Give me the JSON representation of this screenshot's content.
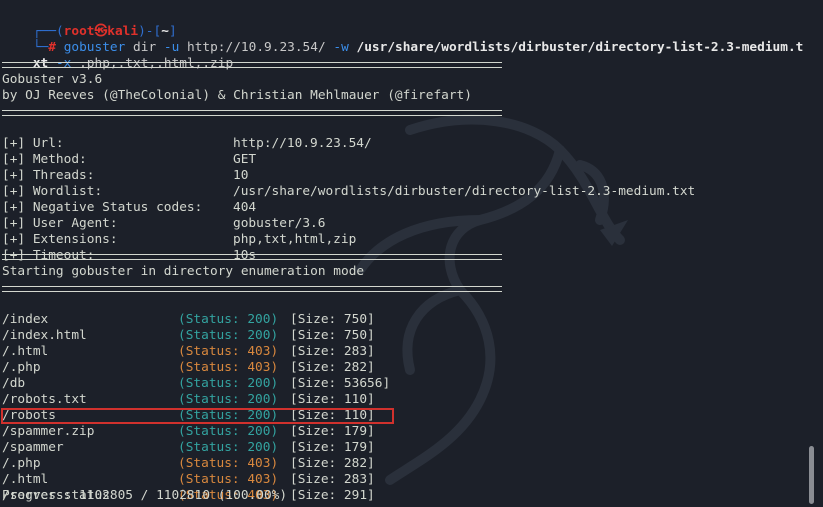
{
  "prompt": {
    "corner_top": "┌──(",
    "user": "root㉿kali",
    "close_paren": ")-[",
    "dir": "~",
    "close_bracket": "]",
    "corner_bottom": "└─",
    "hash": "#"
  },
  "command": {
    "tool": "gobuster",
    "args1": " dir ",
    "flag_u": "-u",
    "url": " http://10.9.23.54/ ",
    "flag_w": "-w",
    "wordlist_part1": " /usr/share/wordlists/dirbuster/directory-list-2.3-medium.t",
    "wordlist_part2": "xt",
    "flag_x": " -x",
    "extensions": " .php,.txt,.html,.zip"
  },
  "banner": {
    "title": "Gobuster v3.6",
    "authors": "by OJ Reeves (@TheColonial) & Christian Mehlmauer (@firefart)"
  },
  "config": [
    {
      "key": "[+] Url:",
      "value": "http://10.9.23.54/"
    },
    {
      "key": "[+] Method:",
      "value": "GET"
    },
    {
      "key": "[+] Threads:",
      "value": "10"
    },
    {
      "key": "[+] Wordlist:",
      "value": "/usr/share/wordlists/dirbuster/directory-list-2.3-medium.txt"
    },
    {
      "key": "[+] Negative Status codes:",
      "value": "404"
    },
    {
      "key": "[+] User Agent:",
      "value": "gobuster/3.6"
    },
    {
      "key": "[+] Extensions:",
      "value": "php,txt,html,zip"
    },
    {
      "key": "[+] Timeout:",
      "value": "10s"
    }
  ],
  "start_message": "Starting gobuster in directory enumeration mode",
  "results": [
    {
      "path": "/index",
      "status": "(Status: 200)",
      "size": "[Size: 750]"
    },
    {
      "path": "/index.html",
      "status": "(Status: 200)",
      "size": "[Size: 750]"
    },
    {
      "path": "/.html",
      "status": "(Status: 403)",
      "size": "[Size: 283]"
    },
    {
      "path": "/.php",
      "status": "(Status: 403)",
      "size": "[Size: 282]"
    },
    {
      "path": "/db",
      "status": "(Status: 200)",
      "size": "[Size: 53656]"
    },
    {
      "path": "/robots.txt",
      "status": "(Status: 200)",
      "size": "[Size: 110]"
    },
    {
      "path": "/robots",
      "status": "(Status: 200)",
      "size": "[Size: 110]"
    },
    {
      "path": "/spammer.zip",
      "status": "(Status: 200)",
      "size": "[Size: 179]"
    },
    {
      "path": "/spammer",
      "status": "(Status: 200)",
      "size": "[Size: 179]"
    },
    {
      "path": "/.php",
      "status": "(Status: 403)",
      "size": "[Size: 282]"
    },
    {
      "path": "/.html",
      "status": "(Status: 403)",
      "size": "[Size: 283]"
    },
    {
      "path": "/server-status",
      "status": "(Status: 403)",
      "size": "[Size: 291]"
    }
  ],
  "progress": "Progress: 1102805 / 1102810 (100.00%)",
  "colors": {
    "background": "#1c2029",
    "status_200": "#33a3a0",
    "status_403": "#d9883e",
    "highlight": "#d0312d",
    "prompt_blue": "#2f6fd0",
    "prompt_red": "#e0312b"
  }
}
